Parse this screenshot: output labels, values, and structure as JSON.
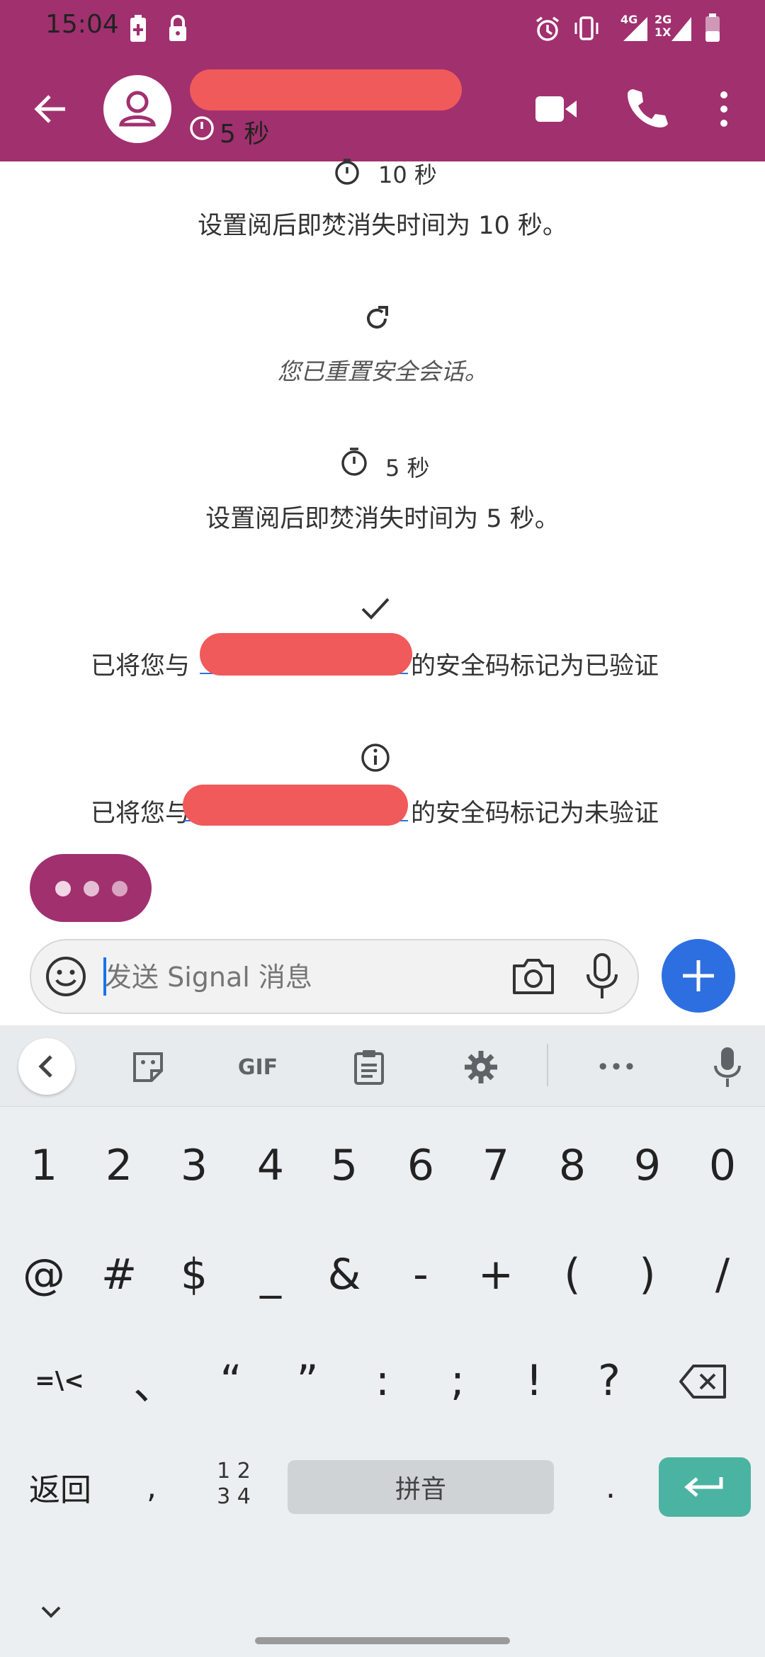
{
  "status_bar": {
    "time": "15:04",
    "network_1": "4G",
    "network_2": "2G",
    "network_2_sub": "1X"
  },
  "header": {
    "timer_label": "5 秒"
  },
  "messages": [
    {
      "timer": "10 秒",
      "text": "设置阅后即焚消失时间为 10 秒。"
    },
    {
      "text": "您已重置安全会话。"
    },
    {
      "timer": "5 秒",
      "text": "设置阅后即焚消失时间为 5 秒。"
    },
    {
      "prefix": "已将您与",
      "suffix": "的安全码标记为已验证"
    },
    {
      "prefix": "已将您与",
      "suffix": "的安全码标记为未验证"
    }
  ],
  "compose": {
    "placeholder": "发送 Signal 消息"
  },
  "keyboard": {
    "toolbar": {
      "gif_label": "GIF",
      "more": "•••"
    },
    "row_numbers": [
      "1",
      "2",
      "3",
      "4",
      "5",
      "6",
      "7",
      "8",
      "9",
      "0"
    ],
    "row_symbols1": [
      "@",
      "#",
      "$",
      "_",
      "&",
      "-",
      "+",
      "(",
      ")",
      "/"
    ],
    "row_symbols2": [
      "=\\<",
      "、",
      "“",
      "”",
      ":",
      ";",
      "!",
      "?"
    ],
    "bottom": {
      "back": "返回",
      "comma": ",",
      "numpad_top": "1 2",
      "numpad_bottom": "3 4",
      "pinyin": "拼音",
      "period": "."
    }
  },
  "colors": {
    "brand": "#a1306f",
    "accent_blue": "#2d6fe0",
    "enter_teal": "#4bb3a2"
  }
}
